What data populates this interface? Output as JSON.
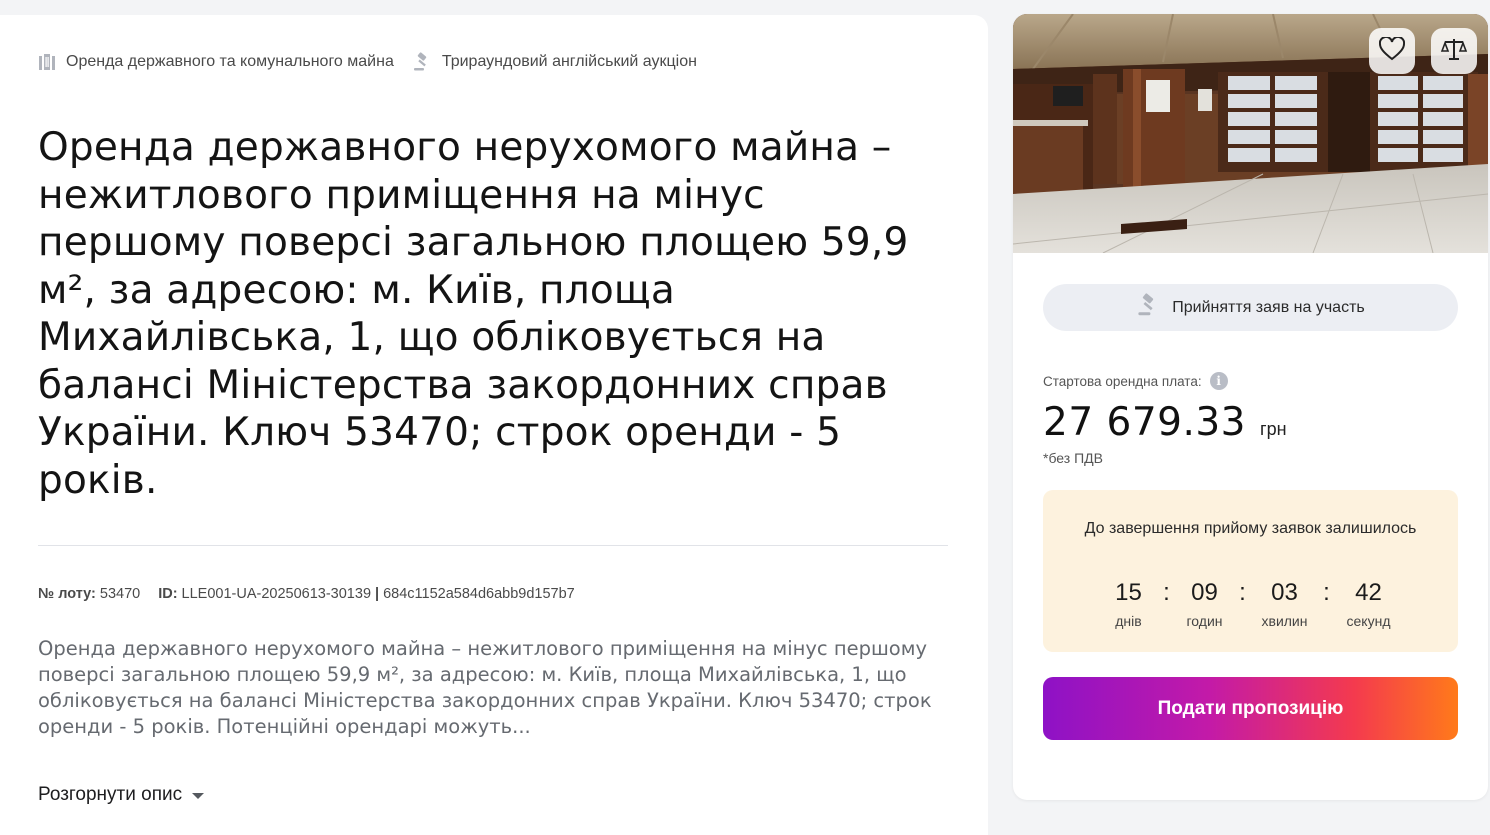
{
  "tags": [
    {
      "icon": "building-columns-icon",
      "label": "Оренда державного та комунального майна"
    },
    {
      "icon": "gavel-icon",
      "label": "Трираундовий англійський аукціон"
    }
  ],
  "lot": {
    "title": "Оренда державного нерухомого майна – нежитлового приміщення на мінус першому поверсі загальною площею 59,9 м², за адресою: м. Київ, площа Михайлівська, 1, що обліковується на балансі Міністерства закордонних справ України. Ключ 53470; строк оренди - 5 років.",
    "lot_number_label": "№ лоту:",
    "lot_number": "53470",
    "id_label": "ID:",
    "id_value": "LLE001-UA-20250613-30139",
    "separator": "|",
    "hash": "684c1152a584d6abb9d157b7",
    "description": "Оренда державного нерухомого майна – нежитлового приміщення на мінус першому поверсі загальною площею 59,9 м², за адресою: м. Київ, площа Михайлівська, 1, що обліковується на балансі Міністерства закордонних справ України. Ключ 53470; строк оренди - 5 років. Потенційні орендарі можуть...",
    "expand_label": "Розгорнути опис"
  },
  "sidebar": {
    "favorite_icon": "heart-icon",
    "compare_icon": "scales-icon",
    "status_icon": "gavel-icon",
    "status": "Прийняття заяв на участь",
    "price_label": "Стартова орендна плата:",
    "price": "27 679.33",
    "currency": "грн",
    "vat_note": "*без ПДВ",
    "countdown": {
      "title": "До завершення прийому заявок залишилось",
      "days": "15",
      "days_label": "днів",
      "hours": "09",
      "hours_label": "годин",
      "minutes": "03",
      "minutes_label": "хвилин",
      "seconds": "42",
      "seconds_label": "секунд",
      "separator": ":"
    },
    "bid_button": "Подати пропозицію"
  },
  "colors": {
    "accent_gradient_start": "#8e12c6",
    "accent_gradient_end": "#ff7a1a",
    "countdown_bg": "#fdf2de",
    "status_pill_bg": "#eceef3"
  }
}
